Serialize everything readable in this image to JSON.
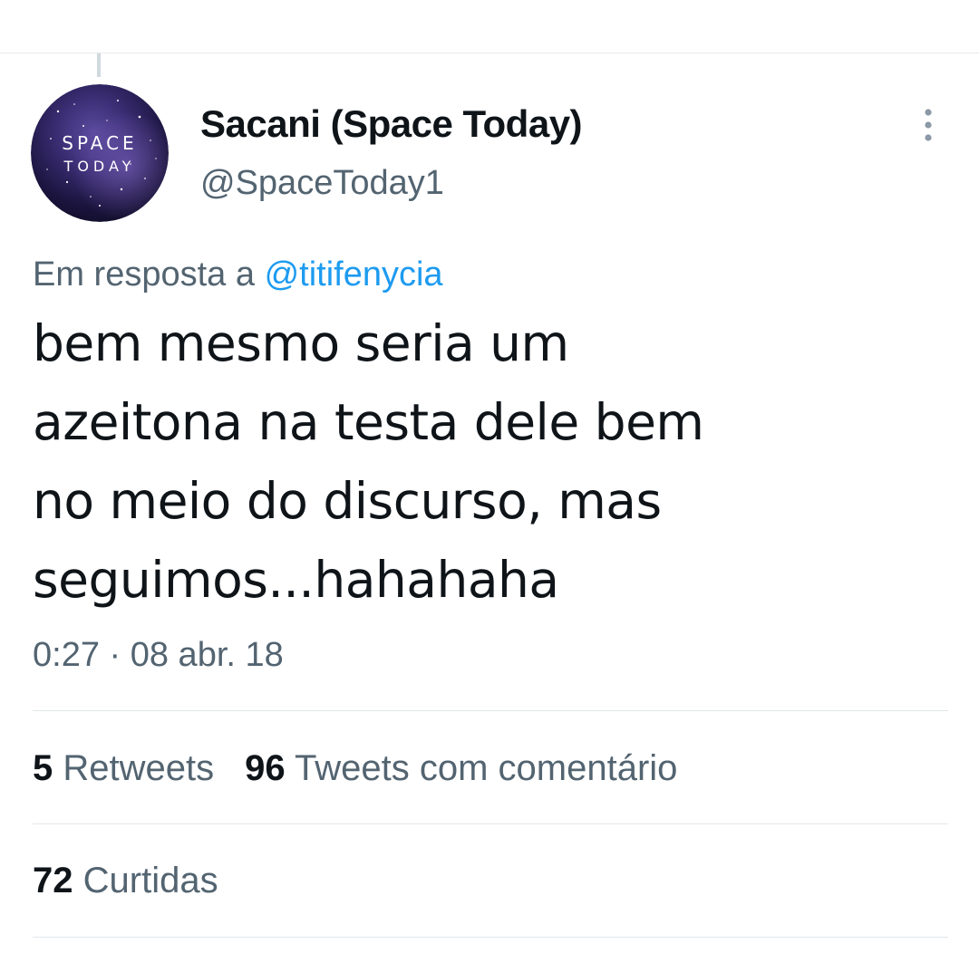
{
  "tweet": {
    "author": {
      "name": "Sacani (Space Today)",
      "handle": "@SpaceToday1",
      "avatar_text": [
        "SPACE",
        "TODAY"
      ]
    },
    "reply_context": {
      "prefix": "Em resposta a",
      "mention": "@titifenycia"
    },
    "text_lines": [
      "bem mesmo seria um",
      "azeitona na testa dele bem",
      "no meio do discurso, mas",
      "seguimos...hahahaha"
    ],
    "timestamp": "0:27 · 08 abr. 18",
    "stats": {
      "retweets": {
        "count": "5",
        "label": "Retweets"
      },
      "quote_tweets": {
        "count": "96",
        "label": "Tweets com comentário"
      },
      "likes": {
        "count": "72",
        "label": "Curtidas"
      }
    }
  },
  "colors": {
    "text_primary": "#0f1419",
    "text_secondary": "#536471",
    "link": "#1d9bf0",
    "divider": "#e3e7ea"
  },
  "icons": {
    "more": "more-vertical-icon"
  }
}
